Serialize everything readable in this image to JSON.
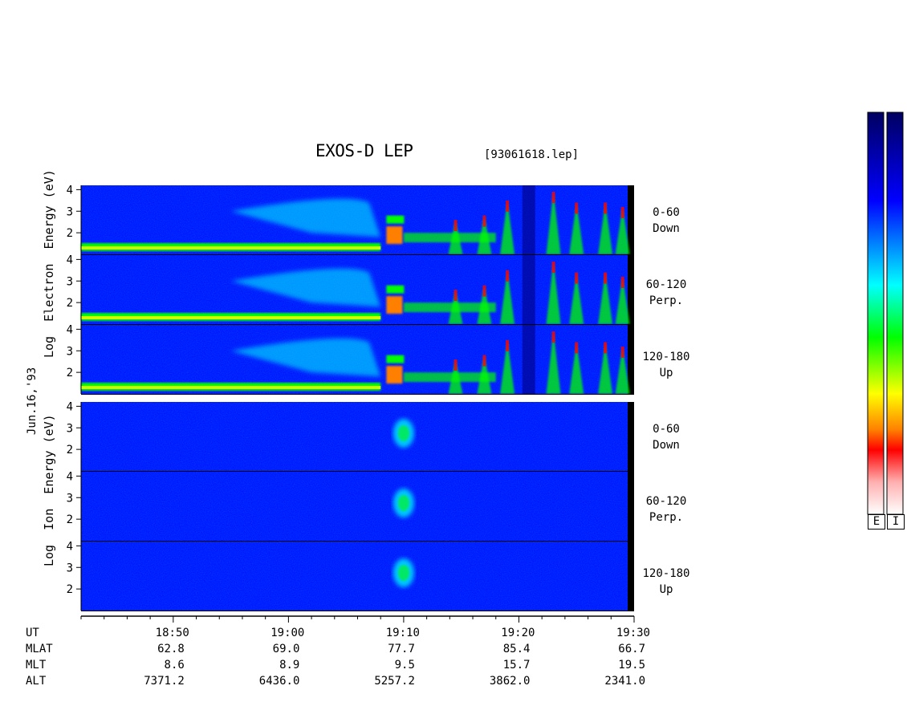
{
  "chart_data": {
    "type": "heatmap",
    "title": "EXOS-D LEP",
    "file_label": "[93061618.lep]",
    "date_label": "Jun.16,'93",
    "colors": {
      "low": "#00007f",
      "blue": "#0000ff",
      "cyan": "#00ffff",
      "green": "#00ff00",
      "yellow": "#ffff00",
      "orange": "#ff8000",
      "red": "#ff0000",
      "pink": "#ffb0b0",
      "white": "#ffffff"
    },
    "groups": [
      {
        "name": "electron",
        "ylabel": "Log Electron Energy (eV)",
        "ylabel_parts": [
          "Log",
          "Electron",
          "Energy (eV)"
        ],
        "panels": [
          {
            "pitch": "0-60",
            "direction": "Down",
            "yticks": [
              "4",
              "3",
              "2"
            ]
          },
          {
            "pitch": "60-120",
            "direction": "Perp.",
            "yticks": [
              "4",
              "3",
              "2"
            ]
          },
          {
            "pitch": "120-180",
            "direction": "Up",
            "yticks": [
              "4",
              "3",
              "2"
            ]
          }
        ]
      },
      {
        "name": "ion",
        "ylabel": "Log Ion Energy (eV)",
        "ylabel_parts": [
          "Log",
          "Ion",
          "Energy (eV)"
        ],
        "panels": [
          {
            "pitch": "0-60",
            "direction": "Down",
            "yticks": [
              "4",
              "3",
              "2"
            ]
          },
          {
            "pitch": "60-120",
            "direction": "Perp.",
            "yticks": [
              "4",
              "3",
              "2"
            ]
          },
          {
            "pitch": "120-180",
            "direction": "Up",
            "yticks": [
              "4",
              "3",
              "2"
            ]
          }
        ]
      }
    ],
    "x": [
      "18:50",
      "19:00",
      "19:10",
      "19:20",
      "19:30"
    ],
    "orbit_rows": [
      {
        "label": "UT",
        "values": [
          "18:50",
          "19:00",
          "19:10",
          "19:20",
          "19:30"
        ]
      },
      {
        "label": "MLAT",
        "values": [
          "62.8",
          "69.0",
          "77.7",
          "85.4",
          "66.7"
        ]
      },
      {
        "label": "MLT",
        "values": [
          "8.6",
          "8.9",
          "9.5",
          "15.7",
          "19.5"
        ]
      },
      {
        "label": "ALT",
        "values": [
          "7371.2",
          "6436.0",
          "5257.2",
          "3862.0",
          "2341.0"
        ]
      }
    ],
    "colorbars": [
      {
        "label": "E"
      },
      {
        "label": "I"
      }
    ],
    "time_range": [
      "18:42",
      "19:30"
    ],
    "energy_range_log10_eV": [
      1,
      4.2
    ]
  }
}
